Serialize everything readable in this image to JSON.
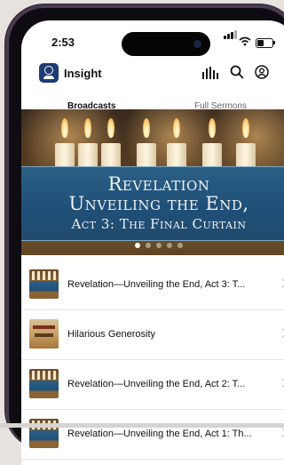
{
  "status_bar": {
    "time": "2:53"
  },
  "app": {
    "name": "Insight"
  },
  "tabs": [
    {
      "label": "Broadcasts",
      "active": true
    },
    {
      "label": "Full Sermons",
      "active": false
    }
  ],
  "hero": {
    "line1": "Revelation",
    "line2": "Unveiling the End,",
    "line3": "Act 3: The Final Curtain",
    "slide_count": 5,
    "active_slide": 1
  },
  "list": [
    {
      "title": "Revelation—Unveiling the End, Act 3: T...",
      "thumb": "revelation-thumbnail"
    },
    {
      "title": "Hilarious Generosity",
      "thumb": "generosity-thumbnail"
    },
    {
      "title": "Revelation—Unveiling the End, Act 2: T...",
      "thumb": "revelation-thumbnail"
    },
    {
      "title": "Revelation—Unveiling the End, Act 1: Th...",
      "thumb": "revelation-thumbnail"
    }
  ],
  "colors": {
    "frame": "#4a3a4e",
    "banner": "#1f5079",
    "logo": "#1d3b74"
  },
  "icons": [
    "logo-icon",
    "audio-bars-icon",
    "search-icon",
    "user-icon",
    "chevron-right-icon"
  ]
}
